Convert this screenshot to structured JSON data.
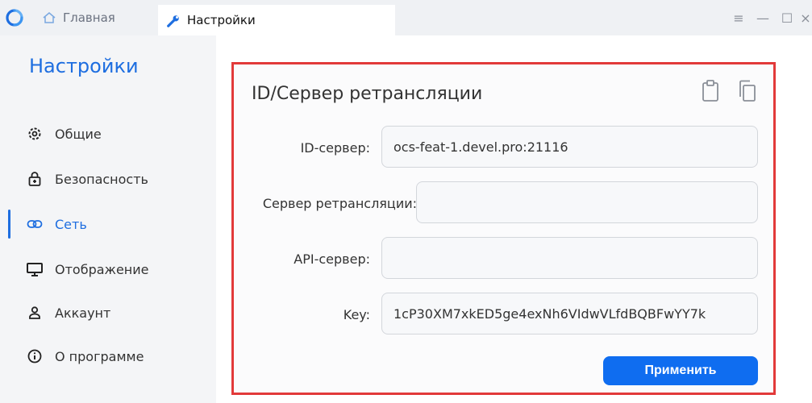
{
  "titlebar": {
    "tabs": [
      {
        "label": "Главная",
        "icon": "home-icon"
      },
      {
        "label": "Настройки",
        "icon": "wrench-icon"
      }
    ],
    "controls": [
      "menu-icon",
      "minimize-icon",
      "maximize-icon",
      "close-icon"
    ]
  },
  "sidebar": {
    "title": "Настройки",
    "items": [
      {
        "label": "Общие",
        "icon": "gear-icon"
      },
      {
        "label": "Безопасность",
        "icon": "lock-icon"
      },
      {
        "label": "Сеть",
        "icon": "link-icon",
        "active": true
      },
      {
        "label": "Отображение",
        "icon": "monitor-icon"
      },
      {
        "label": "Аккаунт",
        "icon": "user-icon"
      },
      {
        "label": "О программе",
        "icon": "info-icon"
      }
    ]
  },
  "panel": {
    "title": "ID/Сервер ретрансляции",
    "actions": [
      "clipboard-icon",
      "copy-icon"
    ],
    "fields": {
      "id_server": {
        "label": "ID-сервер:",
        "value": "ocs-feat-1.devel.pro:21116"
      },
      "relay_server": {
        "label": "Сервер ретрансляции:",
        "value": ""
      },
      "api_server": {
        "label": "API-сервер:",
        "value": ""
      },
      "key": {
        "label": "Key:",
        "value": "1cP30XM7xkED5ge4exNh6VIdwVLfdBQBFwYY7k"
      }
    },
    "apply_label": "Применить"
  },
  "colors": {
    "accent": "#1e6ee0",
    "button": "#0f6df0",
    "highlight": "#e23a3a"
  }
}
